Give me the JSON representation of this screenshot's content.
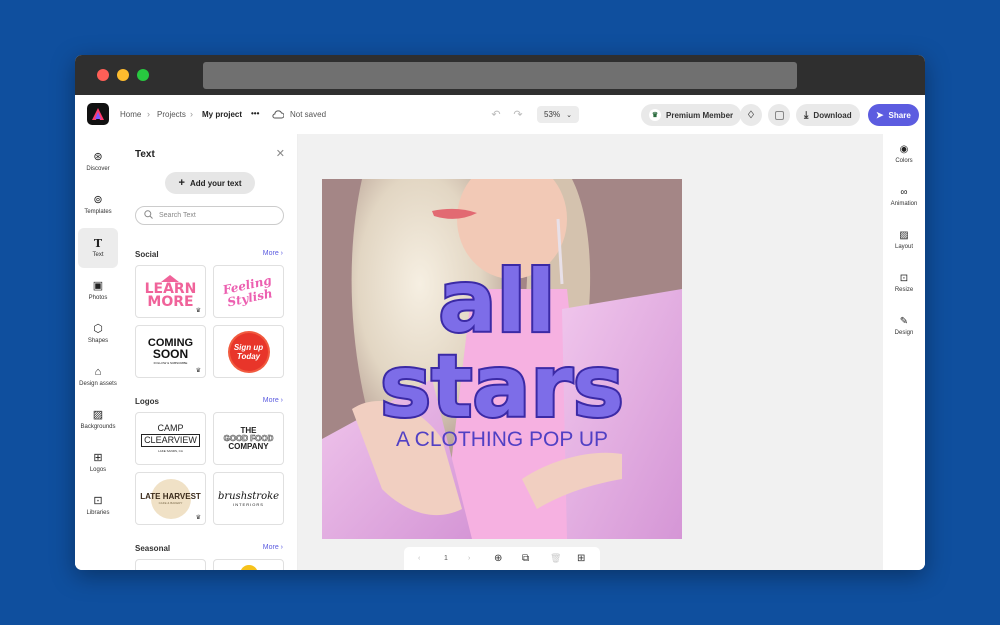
{
  "breadcrumb": {
    "home": "Home",
    "projects": "Projects",
    "current": "My project"
  },
  "more_label": "•••",
  "save_status": "Not saved",
  "zoom": "53%",
  "premium_label": "Premium Member",
  "download_label": "Download",
  "share_label": "Share",
  "left_rail": [
    "Discover",
    "Templates",
    "Text",
    "Photos",
    "Shapes",
    "Design assets",
    "Backgrounds",
    "Logos",
    "Libraries"
  ],
  "panel": {
    "title": "Text",
    "add_text": "Add your text",
    "search_placeholder": "Search Text",
    "sections": [
      {
        "title": "Social",
        "more": "More"
      },
      {
        "title": "Logos",
        "more": "More"
      },
      {
        "title": "Seasonal",
        "more": "More"
      }
    ],
    "cards": {
      "learn_1": "LEARN",
      "learn_2": "MORE",
      "feeling_1": "Feeling",
      "feeling_2": "Stylish",
      "coming_1": "COMING",
      "coming_2": "SOON",
      "coming_3": "FOLLOW & SUBSCRIBE",
      "signup_1": "Sign up",
      "signup_2": "Today",
      "camp_1": "CAMP",
      "camp_2": "CLEARVIEW",
      "camp_3": "LAKE SANDS, CA",
      "good_1": "THE",
      "good_2": "GOOD FOOD",
      "good_3": "COMPANY",
      "harvest_1": "LATE HARVEST",
      "harvest_2": "CAFE & BAKERY",
      "brush_1": "brushstroke",
      "brush_2": "INTERIORS"
    }
  },
  "canvas": {
    "headline_1": "all",
    "headline_2": "stars",
    "subline": "A CLOTHING POP UP"
  },
  "page_number": "1",
  "right_rail": [
    "Colors",
    "Animation",
    "Layout",
    "Resize",
    "Design"
  ],
  "colors": {
    "accent": "#5c5ce0",
    "background": "#0f4f9e",
    "headline_fill": "#7d6de8",
    "headline_stroke": "#3b2aa6"
  }
}
